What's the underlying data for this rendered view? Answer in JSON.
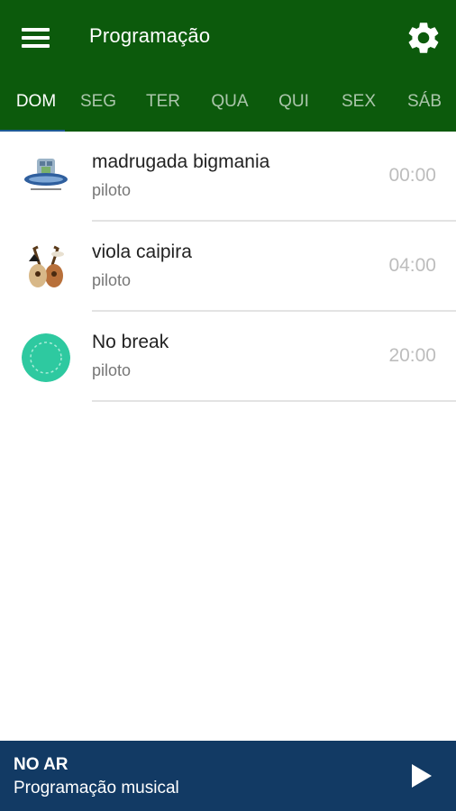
{
  "app": {
    "title": "Programação",
    "menu_icon": "hamburger-menu-icon",
    "settings_icon": "gear-icon",
    "colors": {
      "appbar": "#0c5a0c",
      "player": "#123a64",
      "tab_indicator": "#1e5a96"
    }
  },
  "tabs": [
    {
      "label": "DOM",
      "active": true
    },
    {
      "label": "SEG",
      "active": false
    },
    {
      "label": "TER",
      "active": false
    },
    {
      "label": "QUA",
      "active": false
    },
    {
      "label": "QUI",
      "active": false
    },
    {
      "label": "SEX",
      "active": false
    },
    {
      "label": "SÁB",
      "active": false
    }
  ],
  "programs": [
    {
      "title": "madrugada bigmania",
      "subtitle": "piloto",
      "time": "00:00",
      "icon": "bigmania-logo-icon"
    },
    {
      "title": "viola caipira",
      "subtitle": "piloto",
      "time": "04:00",
      "icon": "guitars-icon"
    },
    {
      "title": "No break",
      "subtitle": "piloto",
      "time": "20:00",
      "icon": "teal-circle-icon"
    }
  ],
  "player": {
    "label": "NO AR",
    "subtitle": "Programação musical",
    "play_icon": "play-icon"
  }
}
